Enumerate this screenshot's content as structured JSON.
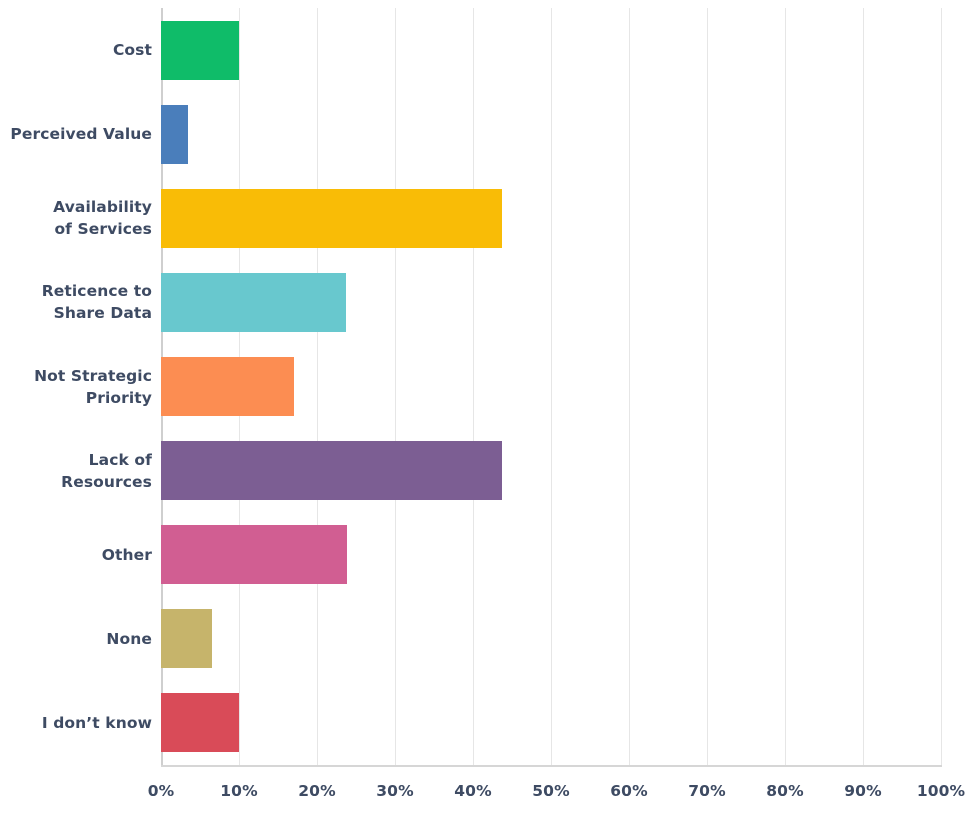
{
  "chart_data": {
    "type": "bar",
    "orientation": "horizontal",
    "title": "",
    "subtitle": "",
    "xlabel": "",
    "ylabel": "",
    "xlim": [
      0,
      100
    ],
    "unit": "%",
    "grid": true,
    "legend": "none",
    "x_tick_labels": [
      "0%",
      "10%",
      "20%",
      "30%",
      "40%",
      "50%",
      "60%",
      "70%",
      "80%",
      "90%",
      "100%"
    ],
    "x_tick_values": [
      0,
      10,
      20,
      30,
      40,
      50,
      60,
      70,
      80,
      90,
      100
    ],
    "categories": [
      "Cost",
      "Perceived Value",
      "Availability\nof Services",
      "Reticence to\nShare Data",
      "Not Strategic\nPriority",
      "Lack of\nResources",
      "Other",
      "None",
      "I don’t know"
    ],
    "values": [
      10.0,
      3.4,
      43.7,
      23.7,
      17.0,
      43.7,
      23.8,
      6.5,
      10.0
    ],
    "colors": [
      "#0fbc69",
      "#4a7ebb",
      "#f9bc06",
      "#68c8ce",
      "#fc8d52",
      "#7c5e93",
      "#d15e92",
      "#c6b46b",
      "#d94b58"
    ],
    "bars": [
      {
        "label": "Cost",
        "value": 10.0,
        "color": "#0fbc69"
      },
      {
        "label": "Perceived Value",
        "value": 3.4,
        "color": "#4a7ebb"
      },
      {
        "label": "Availability of Services",
        "value": 43.7,
        "color": "#f9bc06"
      },
      {
        "label": "Reticence to Share Data",
        "value": 23.7,
        "color": "#68c8ce"
      },
      {
        "label": "Not Strategic Priority",
        "value": 17.0,
        "color": "#fc8d52"
      },
      {
        "label": "Lack of Resources",
        "value": 43.7,
        "color": "#7c5e93"
      },
      {
        "label": "Other",
        "value": 23.8,
        "color": "#d15e92"
      },
      {
        "label": "None",
        "value": 6.5,
        "color": "#c6b46b"
      },
      {
        "label": "I don’t know",
        "value": 10.0,
        "color": "#d94b58"
      }
    ]
  },
  "style": {
    "text_color": "#3e4b63",
    "gridline_color": "#e6e6e6",
    "axis_color": "#cfcfcf",
    "background": "#ffffff"
  }
}
